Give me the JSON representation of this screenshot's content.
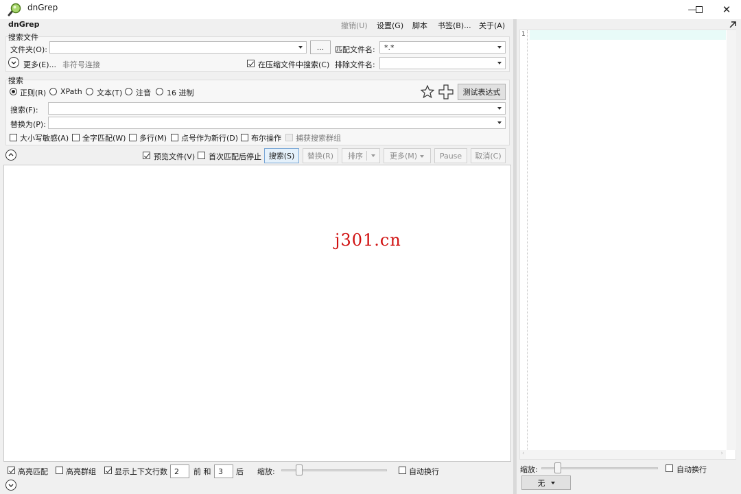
{
  "window": {
    "title": "dnGrep"
  },
  "menu": {
    "app_name": "dnGrep",
    "undo": "撤销(U)",
    "settings": "设置(G)",
    "scripts": "脚本",
    "bookmarks": "书签(B)...",
    "about": "关于(A)"
  },
  "search_files": {
    "group_label": "搜索文件",
    "folder_label": "文件夹(O):",
    "folder_value": "",
    "browse_label": "...",
    "match_files_label": "匹配文件名:",
    "match_files_value": "*.*",
    "more_label": "更多(E)...",
    "non_symlink_label": "非符号连接",
    "archives_label": "在压缩文件中搜索(C)",
    "archives_checked": true,
    "exclude_label": "排除文件名:",
    "exclude_value": ""
  },
  "search": {
    "group_label": "搜索",
    "modes": [
      {
        "label": "正则(R)",
        "selected": true
      },
      {
        "label": "XPath",
        "selected": false
      },
      {
        "label": "文本(T)",
        "selected": false
      },
      {
        "label": "注音",
        "selected": false
      },
      {
        "label": "16 进制",
        "selected": false
      }
    ],
    "test_button": "测试表达式",
    "search_label": "搜索(F):",
    "search_value": "",
    "replace_label": "替换为(P):",
    "replace_value": "",
    "options": [
      {
        "label": "大小写敏感(A)",
        "checked": false,
        "disabled": false
      },
      {
        "label": "全字匹配(W)",
        "checked": false,
        "disabled": false
      },
      {
        "label": "多行(M)",
        "checked": false,
        "disabled": false
      },
      {
        "label": "点号作为新行(D)",
        "checked": false,
        "disabled": false
      },
      {
        "label": "布尔操作",
        "checked": false,
        "disabled": false
      },
      {
        "label": "捕获搜索群组",
        "checked": false,
        "disabled": true
      }
    ]
  },
  "actions": {
    "preview_label": "预览文件(V)",
    "preview_checked": true,
    "stop_first_label": "首次匹配后停止",
    "stop_first_checked": false,
    "search_button": "搜索(S)",
    "replace_button": "替换(R)",
    "sort_button": "排序",
    "more_button": "更多(M)",
    "pause_button": "Pause",
    "cancel_button": "取消(C)"
  },
  "results": {
    "watermark": "j301.cn"
  },
  "bottom": {
    "highlight_matches": "高亮匹配",
    "highlight_matches_checked": true,
    "highlight_groups": "高亮群组",
    "highlight_groups_checked": false,
    "show_context": "显示上下文行数",
    "show_context_checked": true,
    "before_value": "2",
    "before_label": "前 和",
    "after_value": "3",
    "after_label": "后",
    "zoom_label": "缩放:",
    "word_wrap": "自动换行",
    "word_wrap_checked": false
  },
  "preview": {
    "line_number": "1",
    "zoom_label": "缩放:",
    "word_wrap": "自动换行",
    "word_wrap_checked": false,
    "syntax_value": "无"
  }
}
